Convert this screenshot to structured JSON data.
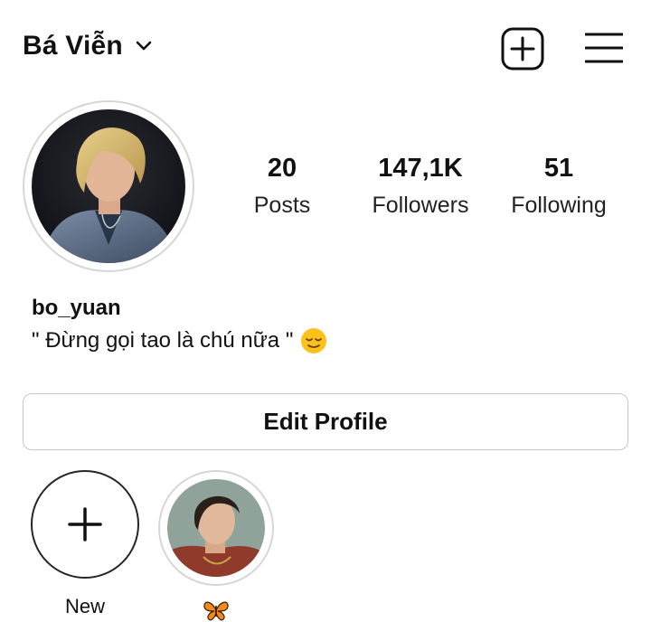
{
  "header": {
    "account_name": "Bá Viễn",
    "icons": [
      "chevron-down-icon",
      "new-post-icon",
      "menu-icon"
    ]
  },
  "profile": {
    "handle": "bo_yuan",
    "bio": "\" Đừng gọi tao là chú nữa \"",
    "bio_emoji": "relieved-face-emoji"
  },
  "stats": {
    "posts": {
      "value": "20",
      "label": "Posts"
    },
    "followers": {
      "value": "147,1K",
      "label": "Followers"
    },
    "following": {
      "value": "51",
      "label": "Following"
    }
  },
  "edit_profile_label": "Edit Profile",
  "highlights": [
    {
      "label": "New",
      "icon": "plus-icon"
    },
    {
      "label": "",
      "icon": "butterfly-emoji"
    }
  ],
  "colors": {
    "text": "#111111",
    "ring": "#d6d6d6",
    "border": "#c8c8c8",
    "background": "#ffffff"
  }
}
